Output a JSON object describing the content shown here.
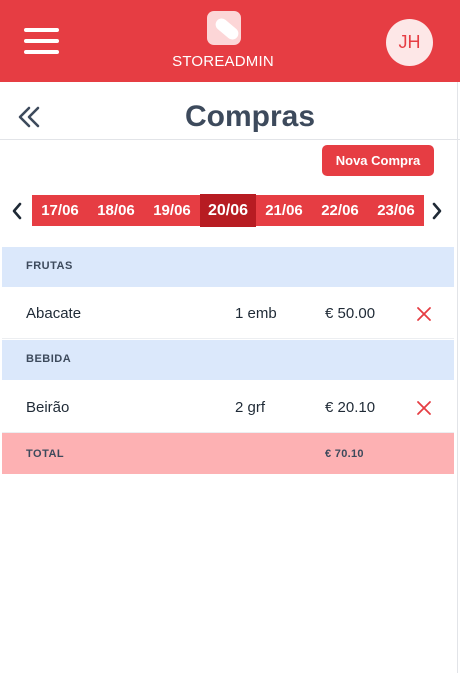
{
  "header": {
    "brand": "STOREADMIN",
    "avatar_initials": "JH",
    "accent_color": "#e63d43"
  },
  "page": {
    "title": "Compras",
    "new_button_label": "Nova Compra"
  },
  "dates": {
    "items": [
      "17/06",
      "18/06",
      "19/06",
      "20/06",
      "21/06",
      "22/06",
      "23/06"
    ],
    "active": "20/06"
  },
  "categories": [
    {
      "name": "FRUTAS",
      "items": [
        {
          "name": "Abacate",
          "qty": "1 emb",
          "price": "€ 50.00"
        }
      ]
    },
    {
      "name": "BEBIDA",
      "items": [
        {
          "name": "Beirão",
          "qty": "2 grf",
          "price": "€ 20.10"
        }
      ]
    }
  ],
  "total": {
    "label": "TOTAL",
    "value": "€ 70.10"
  },
  "icons": {
    "menu": "hamburger-icon",
    "logo": "tag-logo-icon",
    "back": "double-chevron-left-icon",
    "prev": "chevron-left-icon",
    "next": "chevron-right-icon",
    "delete": "close-icon"
  }
}
